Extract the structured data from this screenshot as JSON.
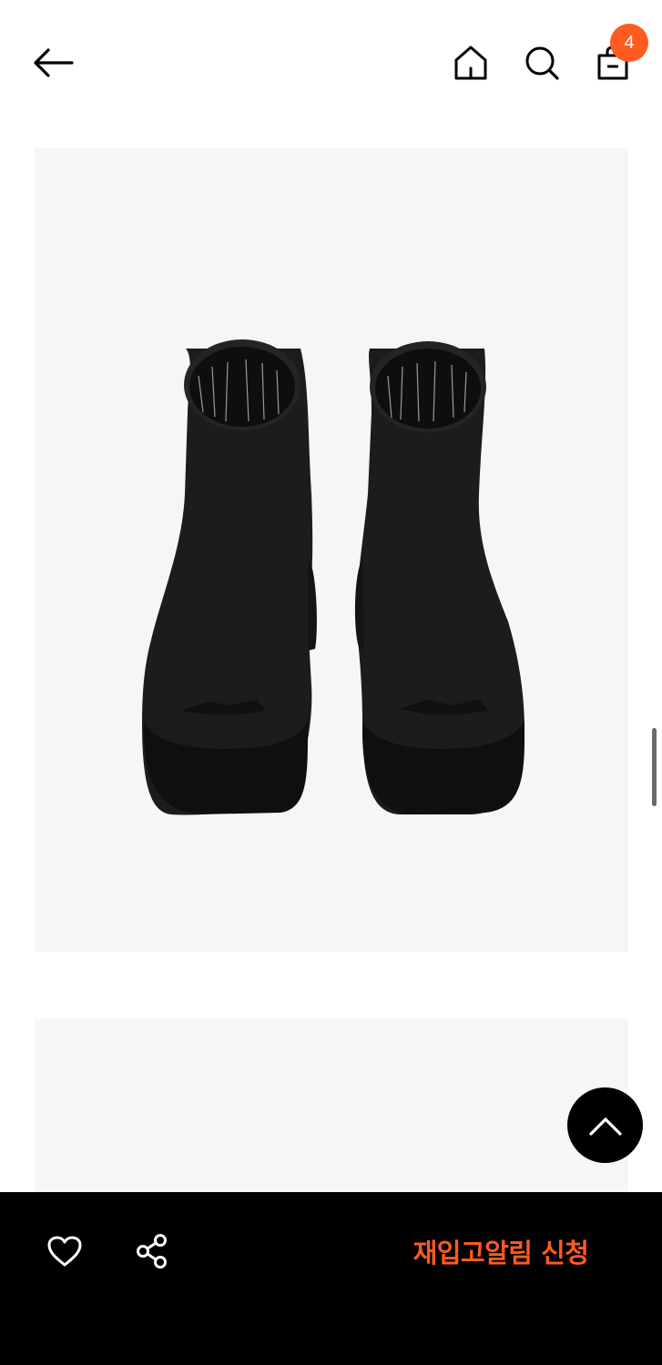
{
  "header": {
    "cart_count": "4"
  },
  "colors": {
    "accent": "#ff5a1f",
    "image_bg": "#f6f6f6",
    "bottom_bar_bg": "#000000"
  },
  "icons": [
    "back-arrow-icon",
    "home-icon",
    "search-icon",
    "shopping-bag-icon",
    "chevron-up-icon",
    "heart-icon",
    "share-icon"
  ],
  "bottom_bar": {
    "restock_label": "재입고알림 신청"
  }
}
